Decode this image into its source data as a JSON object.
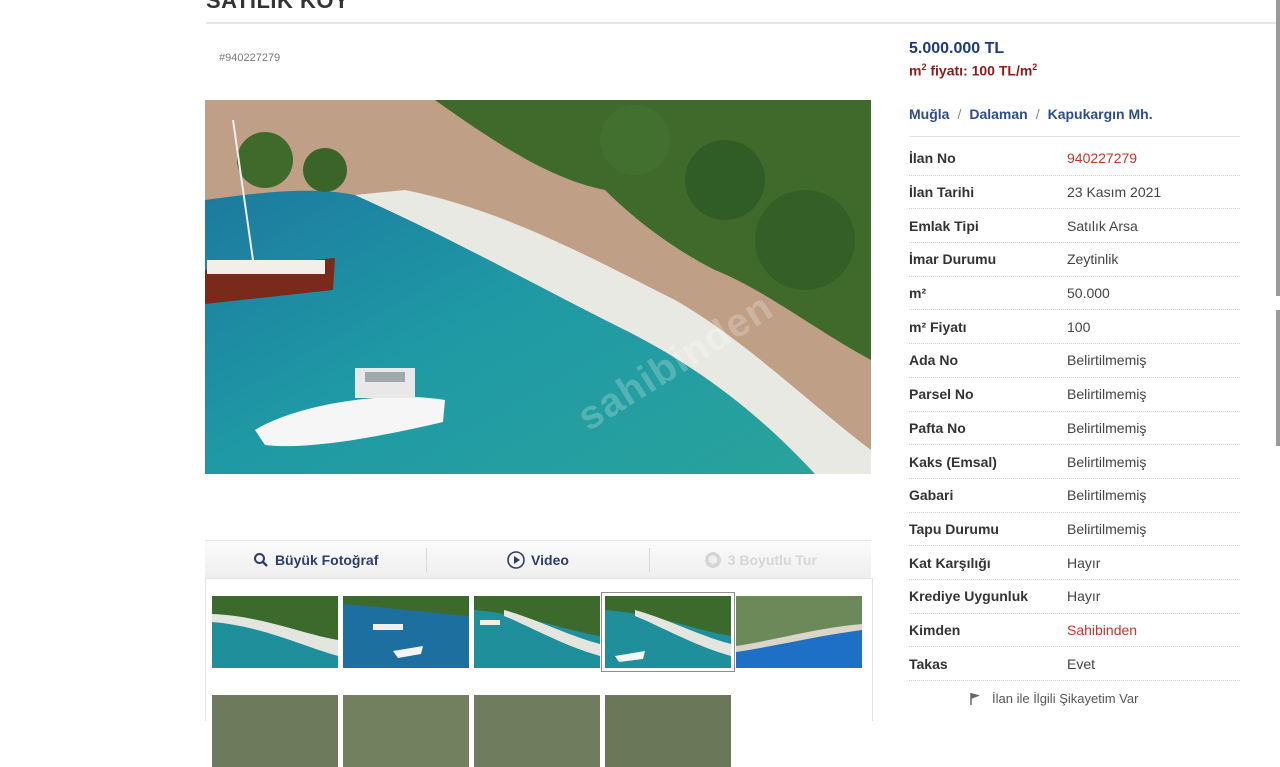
{
  "page": {
    "title": "SATILIK KÖY",
    "listing_id_tag": "#940227279"
  },
  "photo": {
    "watermark": "sahibinden"
  },
  "photo_tabs": [
    {
      "label": "Büyük Fotoğraf",
      "icon": "search-icon",
      "enabled": true
    },
    {
      "label": "Video",
      "icon": "play-circle-icon",
      "enabled": true
    },
    {
      "label": "3 Boyutlu Tur",
      "icon": "cube-icon",
      "enabled": false
    }
  ],
  "thumbnails": {
    "count_visible": 9,
    "selected_index": 3
  },
  "summary": {
    "price": "5.000.000 TL",
    "m2_price_prefix": "m",
    "m2_price_sup": "2",
    "m2_price_middle": " fiyatı: 100 TL/m",
    "m2_price_sup2": "2"
  },
  "breadcrumb": [
    "Muğla",
    "Dalaman",
    "Kapukargın Mh."
  ],
  "details": [
    {
      "key": "İlan No",
      "value": "940227279",
      "highlight": true
    },
    {
      "key": "İlan Tarihi",
      "value": "23 Kasım 2021"
    },
    {
      "key": "Emlak Tipi",
      "value": "Satılık Arsa"
    },
    {
      "key": "İmar Durumu",
      "value": "Zeytinlik"
    },
    {
      "key": "m²",
      "value": "50.000"
    },
    {
      "key": "m² Fiyatı",
      "value": "100"
    },
    {
      "key": "Ada No",
      "value": "Belirtilmemiş"
    },
    {
      "key": "Parsel No",
      "value": "Belirtilmemiş"
    },
    {
      "key": "Pafta No",
      "value": "Belirtilmemiş"
    },
    {
      "key": "Kaks (Emsal)",
      "value": "Belirtilmemiş"
    },
    {
      "key": "Gabari",
      "value": "Belirtilmemiş"
    },
    {
      "key": "Tapu Durumu",
      "value": "Belirtilmemiş"
    },
    {
      "key": "Kat Karşılığı",
      "value": "Hayır"
    },
    {
      "key": "Krediye Uygunluk",
      "value": "Hayır"
    },
    {
      "key": "Kimden",
      "value": "Sahibinden",
      "highlight": true
    },
    {
      "key": "Takas",
      "value": "Evet"
    }
  ],
  "complaint": {
    "label": "İlan ile İlgili Şikayetim Var",
    "icon": "flag-icon"
  },
  "colors": {
    "price_blue": "#1d3a7a",
    "accent_red": "#c7352c",
    "m2_red": "#8b1c1c"
  }
}
